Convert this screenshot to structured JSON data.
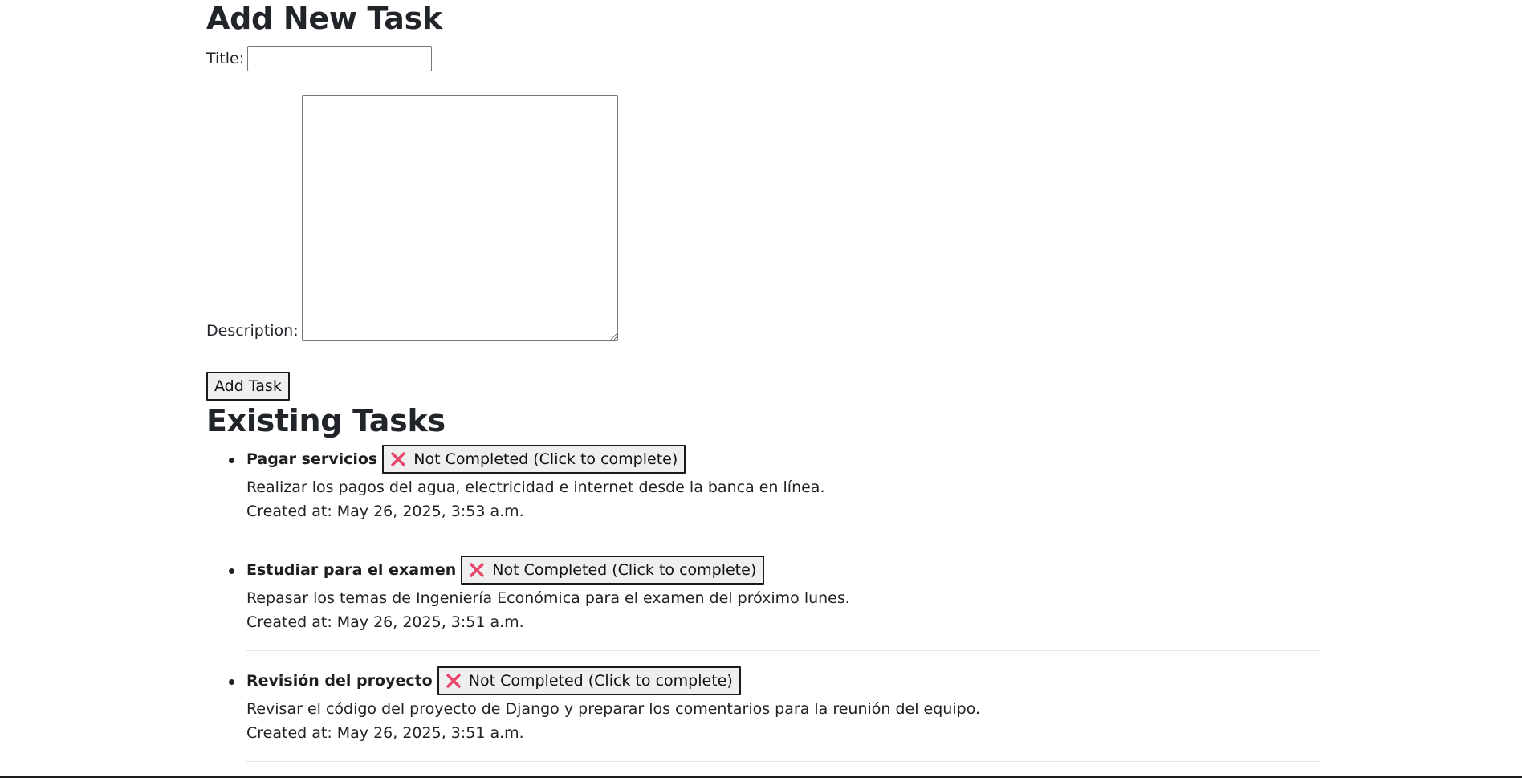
{
  "form": {
    "heading": "Add New Task",
    "title_label": "Title:",
    "title_value": "",
    "description_label": "Description:",
    "description_value": "",
    "submit_label": "Add Task"
  },
  "tasks_section": {
    "heading": "Existing Tasks",
    "tasks": [
      {
        "title": "Pagar servicios",
        "status_label": "Not Completed (Click to complete)",
        "status_icon": "cross-mark-icon",
        "description": "Realizar los pagos del agua, electricidad e internet desde la banca en línea.",
        "created": "Created at: May 26, 2025, 3:53 a.m."
      },
      {
        "title": "Estudiar para el examen",
        "status_label": "Not Completed (Click to complete)",
        "status_icon": "cross-mark-icon",
        "description": "Repasar los temas de Ingeniería Económica para el examen del próximo lunes.",
        "created": "Created at: May 26, 2025, 3:51 a.m."
      },
      {
        "title": "Revisión del proyecto",
        "status_label": "Not Completed (Click to complete)",
        "status_icon": "cross-mark-icon",
        "description": "Revisar el código del proyecto de Django y preparar los comentarios para la reunión del equipo.",
        "created": "Created at: May 26, 2025, 3:51 a.m."
      }
    ]
  },
  "colors": {
    "text": "#212529",
    "cross_icon": "#e8456b",
    "button_bg": "#efefef",
    "divider": "#e6e6e6"
  }
}
